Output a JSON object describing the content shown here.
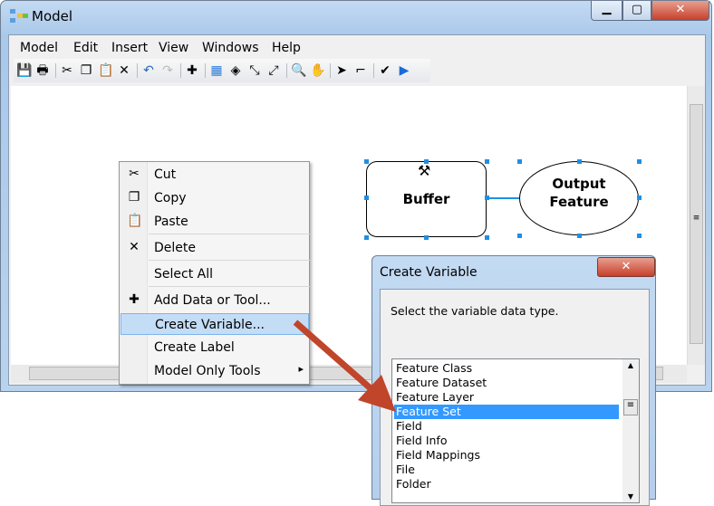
{
  "window": {
    "title": "Model",
    "icon": "model-builder-icon"
  },
  "menubar": [
    "Model",
    "Edit",
    "Insert",
    "View",
    "Windows",
    "Help"
  ],
  "toolbar": [
    {
      "icon": "save-icon",
      "g": "💾"
    },
    {
      "icon": "print-icon",
      "g": "🖶"
    },
    {
      "icon": "cut-icon",
      "g": "✂"
    },
    {
      "icon": "copy-icon",
      "g": "❐"
    },
    {
      "icon": "paste-icon",
      "g": "📋"
    },
    {
      "icon": "delete-icon",
      "g": "✕"
    },
    {
      "icon": "undo-icon",
      "g": "↶"
    },
    {
      "icon": "redo-icon",
      "g": "↷"
    },
    {
      "icon": "add-data-icon",
      "g": "✚"
    },
    {
      "icon": "auto-layout-icon",
      "g": "▦"
    },
    {
      "icon": "full-extent-icon",
      "g": "◈"
    },
    {
      "icon": "zoom-in-fixed-icon",
      "g": "⤡"
    },
    {
      "icon": "zoom-out-fixed-icon",
      "g": "⤢"
    },
    {
      "icon": "zoom-icon",
      "g": "🔍"
    },
    {
      "icon": "pan-icon",
      "g": "✋"
    },
    {
      "icon": "select-icon",
      "g": "➤"
    },
    {
      "icon": "connect-icon",
      "g": "⌐"
    },
    {
      "icon": "validate-icon",
      "g": "✔"
    },
    {
      "icon": "run-icon",
      "g": "▶"
    }
  ],
  "diagram": {
    "tool": "Buffer",
    "output_line1": "Output",
    "output_line2": "Feature"
  },
  "context_menu": [
    {
      "label": "Cut",
      "icon": "cut-icon",
      "g": "✂"
    },
    {
      "label": "Copy",
      "icon": "copy-icon",
      "g": "❐"
    },
    {
      "label": "Paste",
      "icon": "paste-icon",
      "g": "📋"
    },
    {
      "label": "Delete",
      "icon": "delete-icon",
      "g": "✕"
    },
    {
      "label": "Select All",
      "icon": "",
      "g": ""
    },
    {
      "label": "Add Data or Tool...",
      "icon": "add-data-icon",
      "g": "✚"
    },
    {
      "label": "Create Variable...",
      "icon": "",
      "g": "",
      "highlighted": true
    },
    {
      "label": "Create Label",
      "icon": "",
      "g": ""
    },
    {
      "label": "Model Only Tools",
      "icon": "",
      "g": "",
      "submenu": true
    }
  ],
  "dialog": {
    "title": "Create Variable",
    "prompt": "Select the variable data type.",
    "items": [
      "Feature Class",
      "Feature Dataset",
      "Feature Layer",
      "Feature Set",
      "Field",
      "Field Info",
      "Field Mappings",
      "File",
      "Folder"
    ],
    "selected": "Feature Set"
  },
  "colors": {
    "highlight": "#3399ff",
    "arrow": "#c0452a",
    "handles": "#1e8fe6"
  }
}
